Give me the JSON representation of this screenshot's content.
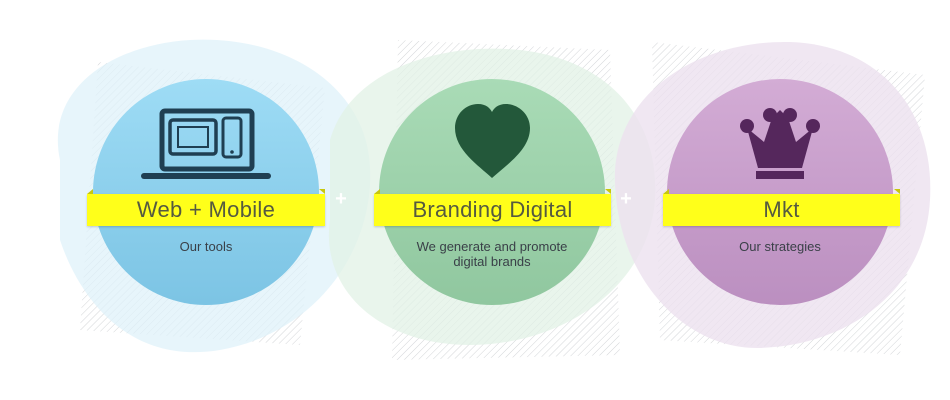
{
  "services": [
    {
      "title": "Web + Mobile",
      "caption": "Our tools",
      "icon": "devices-icon",
      "color": "#8fd2ee"
    },
    {
      "title": "Branding Digital",
      "caption": "We generate and promote digital brands",
      "icon": "heart-icon",
      "color": "#9fd2ae"
    },
    {
      "title": "Mkt",
      "caption": "Our strategies",
      "icon": "crown-icon",
      "color": "#c79cc9"
    }
  ],
  "separators": [
    "+",
    "+"
  ],
  "colors": {
    "ribbon": "#ffff1a",
    "icon_dark_blue": "#1f3f52",
    "icon_dark_green": "#23583a",
    "icon_dark_purple": "#55275c"
  }
}
